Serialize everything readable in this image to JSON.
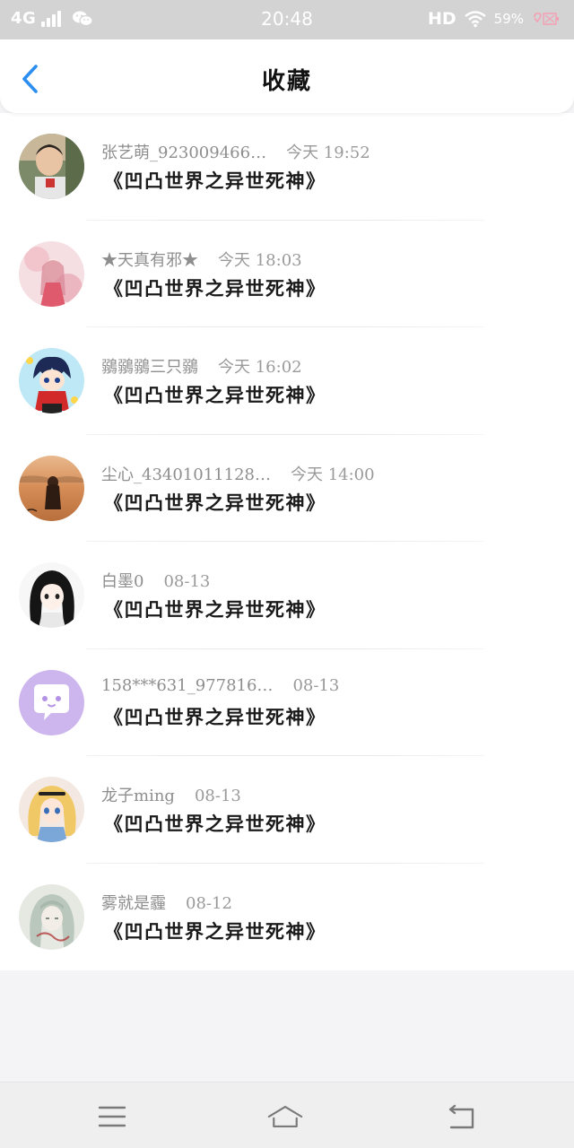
{
  "status_bar": {
    "network": "4G",
    "time": "20:48",
    "hd": "HD",
    "battery": "59%",
    "icons": [
      "signal-icon",
      "wechat-icon",
      "wifi-icon",
      "battery-icon"
    ]
  },
  "header": {
    "title": "收藏",
    "back_icon": "chevron-left-icon",
    "accent_color": "#2b8ef0"
  },
  "favorites": [
    {
      "name": "张艺萌_923009466…",
      "time": "今天 19:52",
      "title": "《凹凸世界之异世死神》",
      "avatar": "photo-child"
    },
    {
      "name": "★天真有邪★",
      "time": "今天 18:03",
      "title": "《凹凸世界之异世死神》",
      "avatar": "pink-anime-girl"
    },
    {
      "name": "鶸鶸鶸三只鶸",
      "time": "今天 16:02",
      "title": "《凹凸世界之异世死神》",
      "avatar": "chibi-boy"
    },
    {
      "name": "尘心_43401011128…",
      "time": "今天 14:00",
      "title": "《凹凸世界之异世死神》",
      "avatar": "sunset-girl"
    },
    {
      "name": "白墨0",
      "time": "08-13",
      "title": "《凹凸世界之异世死神》",
      "avatar": "black-hair-girl"
    },
    {
      "name": "158***631_977816…",
      "time": "08-13",
      "title": "《凹凸世界之异世死神》",
      "avatar": "default-chat"
    },
    {
      "name": "龙子ming",
      "time": "08-13",
      "title": "《凹凸世界之异世死神》",
      "avatar": "blonde-girl"
    },
    {
      "name": "雾就是霾",
      "time": "08-12",
      "title": "《凹凸世界之异世死神》",
      "avatar": "sketch-girl"
    }
  ],
  "nav_bar": {
    "buttons": [
      "menu-icon",
      "home-icon",
      "back-icon"
    ]
  }
}
